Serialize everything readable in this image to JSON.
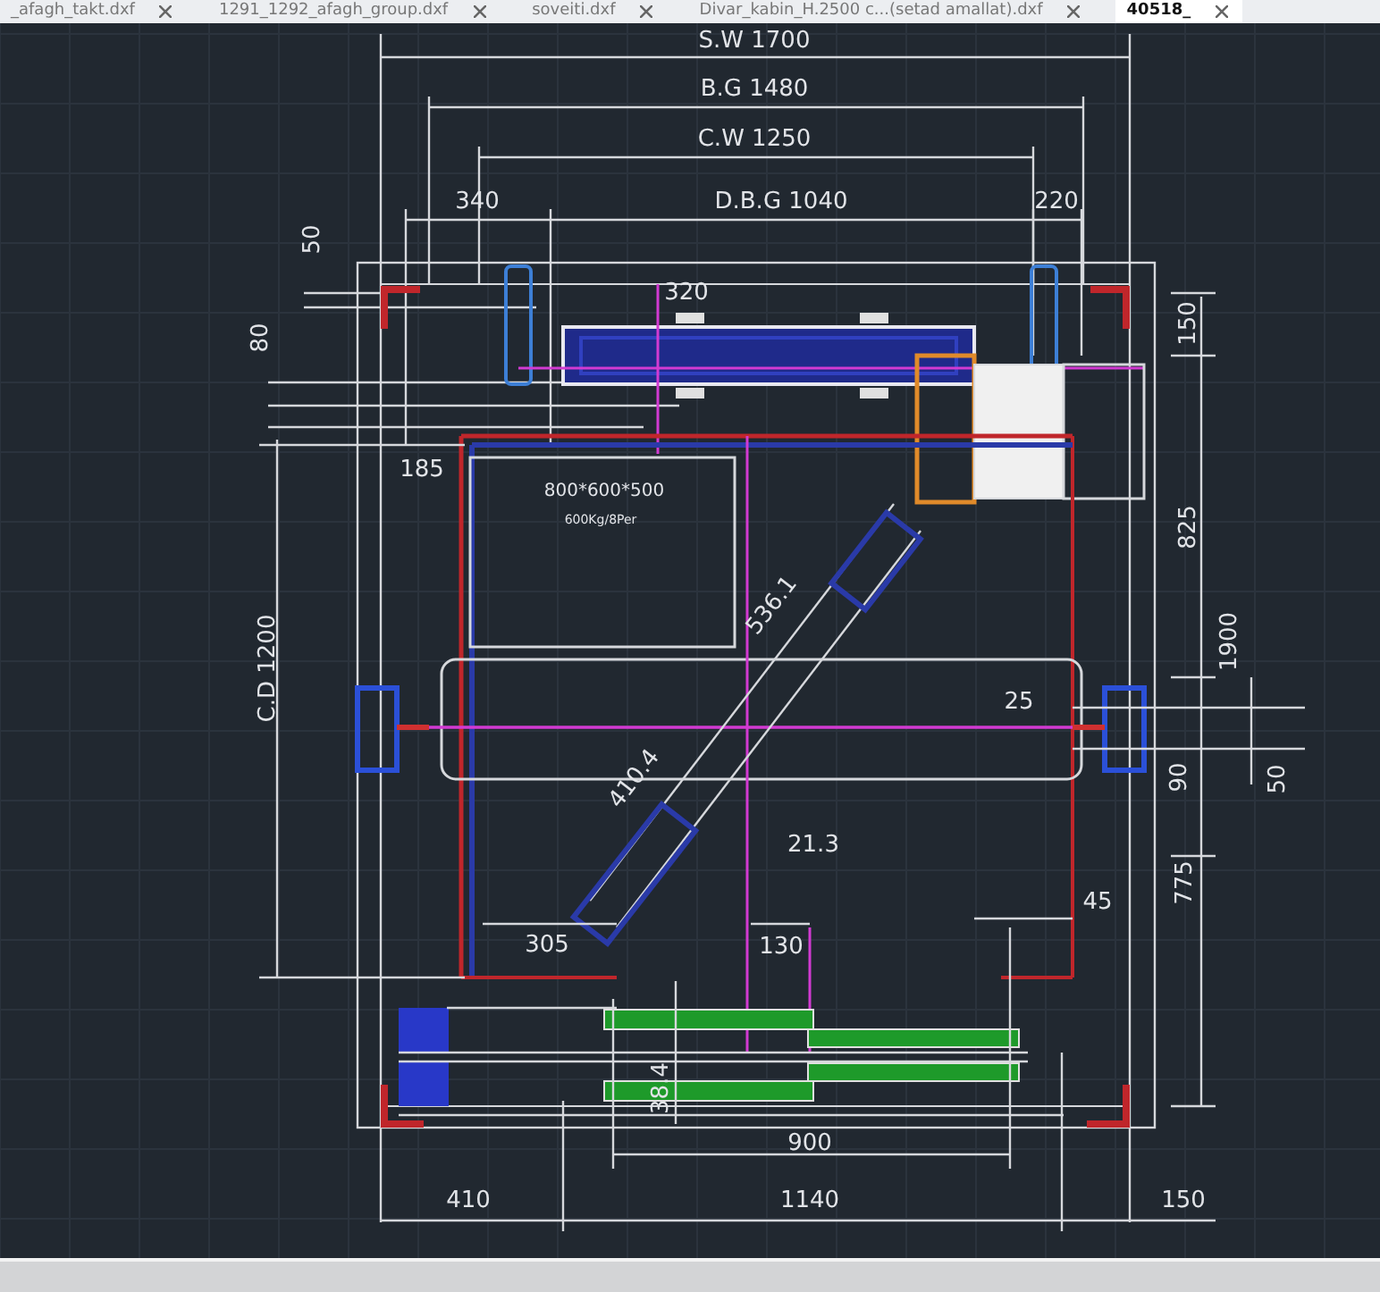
{
  "tabs": [
    {
      "label": "_afagh_takt.dxf",
      "selected": false
    },
    {
      "label": "1291_1292_afagh_group.dxf",
      "selected": false
    },
    {
      "label": "soveiti.dxf",
      "selected": false
    },
    {
      "label": "Divar_kabin_H.2500 c...(setad amallat).dxf",
      "selected": false
    },
    {
      "label": "40518_",
      "selected": true
    }
  ],
  "drawing": {
    "labels": [
      {
        "text": "S.W 1700",
        "kind": "horizontal"
      },
      {
        "text": "B.G 1480",
        "kind": "horizontal"
      },
      {
        "text": "C.W 1250",
        "kind": "horizontal"
      },
      {
        "text": "340",
        "kind": "horizontal"
      },
      {
        "text": "D.B.G 1040",
        "kind": "horizontal"
      },
      {
        "text": "220",
        "kind": "horizontal"
      },
      {
        "text": "50",
        "kind": "vertical"
      },
      {
        "text": "320",
        "kind": "horizontal"
      },
      {
        "text": "150",
        "kind": "vertical"
      },
      {
        "text": "80",
        "kind": "vertical"
      },
      {
        "text": "185",
        "kind": "horizontal"
      },
      {
        "text": "800*600*500",
        "kind": "horizontal"
      },
      {
        "text": "600Kg/8Per",
        "kind": "horizontal"
      },
      {
        "text": "825",
        "kind": "vertical"
      },
      {
        "text": "536.1",
        "kind": "diagonal"
      },
      {
        "text": "1900",
        "kind": "vertical"
      },
      {
        "text": "C.D 1200",
        "kind": "vertical"
      },
      {
        "text": "25",
        "kind": "horizontal"
      },
      {
        "text": "410.4",
        "kind": "diagonal"
      },
      {
        "text": "90",
        "kind": "vertical"
      },
      {
        "text": "50",
        "kind": "vertical"
      },
      {
        "text": "21.3",
        "kind": "horizontal"
      },
      {
        "text": "775",
        "kind": "vertical"
      },
      {
        "text": "45",
        "kind": "horizontal"
      },
      {
        "text": "305",
        "kind": "horizontal"
      },
      {
        "text": "130",
        "kind": "horizontal"
      },
      {
        "text": "38.4",
        "kind": "vertical"
      },
      {
        "text": "900",
        "kind": "horizontal"
      },
      {
        "text": "410",
        "kind": "horizontal"
      },
      {
        "text": "1140",
        "kind": "horizontal"
      },
      {
        "text": "150",
        "kind": "horizontal"
      }
    ]
  }
}
